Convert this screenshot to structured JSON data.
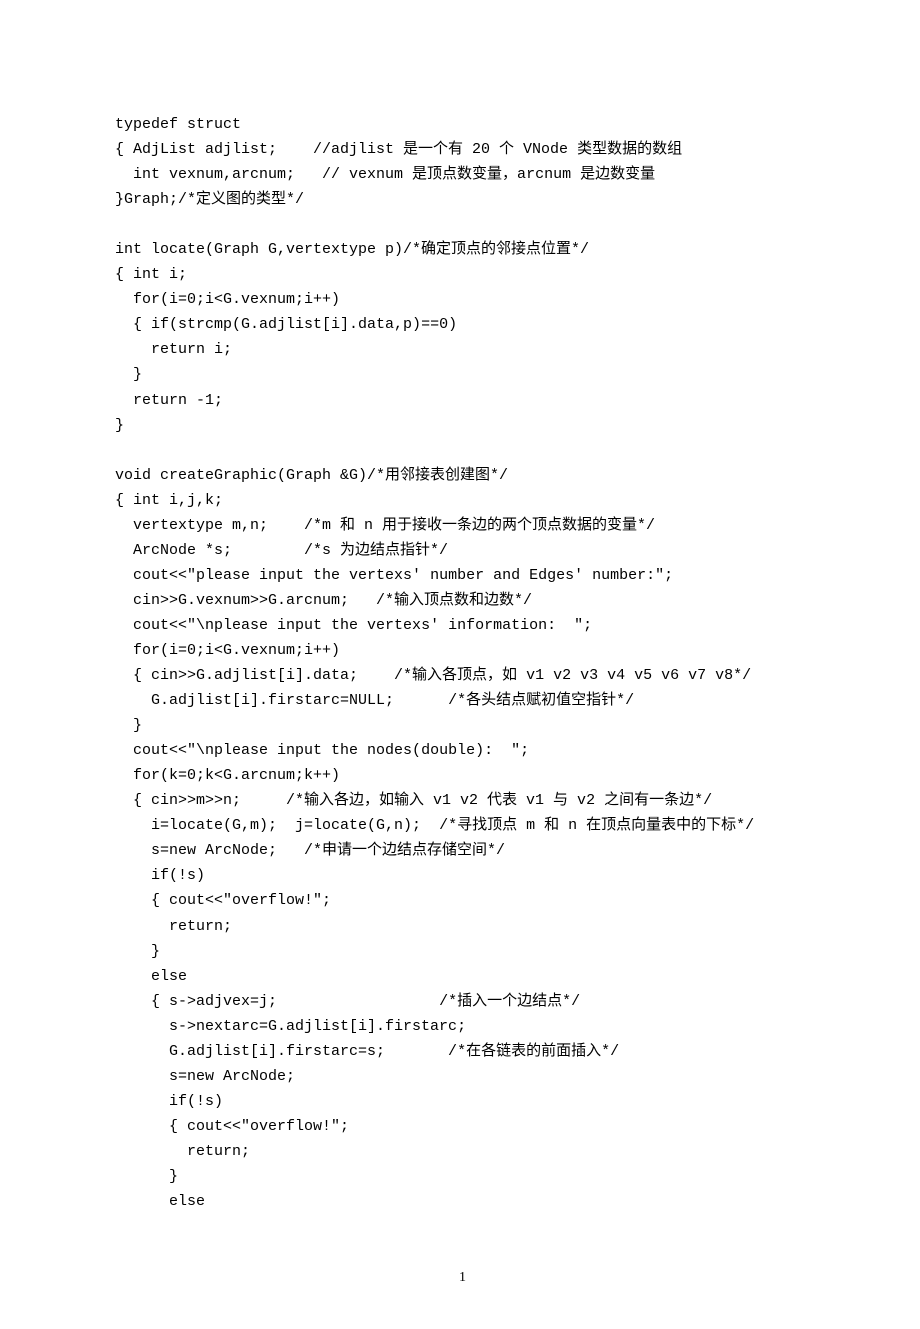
{
  "code": [
    "typedef struct",
    "{ AdjList adjlist;    //adjlist 是一个有 20 个 VNode 类型数据的数组",
    "  int vexnum,arcnum;   // vexnum 是顶点数变量，arcnum 是边数变量",
    "}Graph;/*定义图的类型*/",
    "",
    "int locate(Graph G,vertextype p)/*确定顶点的邻接点位置*/",
    "{ int i;",
    "  for(i=0;i<G.vexnum;i++)",
    "  { if(strcmp(G.adjlist[i].data,p)==0)",
    "    return i;",
    "  }",
    "  return -1;",
    "}",
    "",
    "void createGraphic(Graph &G)/*用邻接表创建图*/",
    "{ int i,j,k;",
    "  vertextype m,n;    /*m 和 n 用于接收一条边的两个顶点数据的变量*/",
    "  ArcNode *s;        /*s 为边结点指针*/",
    "  cout<<\"please input the vertexs' number and Edges' number:\";",
    "  cin>>G.vexnum>>G.arcnum;   /*输入顶点数和边数*/",
    "  cout<<\"\\nplease input the vertexs' information:  \";",
    "  for(i=0;i<G.vexnum;i++)",
    "  { cin>>G.adjlist[i].data;    /*输入各顶点，如 v1 v2 v3 v4 v5 v6 v7 v8*/",
    "    G.adjlist[i].firstarc=NULL;      /*各头结点赋初值空指针*/",
    "  }",
    "  cout<<\"\\nplease input the nodes(double):  \";",
    "  for(k=0;k<G.arcnum;k++)",
    "  { cin>>m>>n;     /*输入各边，如输入 v1 v2 代表 v1 与 v2 之间有一条边*/",
    "    i=locate(G,m);  j=locate(G,n);  /*寻找顶点 m 和 n 在顶点向量表中的下标*/",
    "    s=new ArcNode;   /*申请一个边结点存储空间*/",
    "    if(!s)",
    "    { cout<<\"overflow!\";",
    "      return;",
    "    }",
    "    else",
    "    { s->adjvex=j;                  /*插入一个边结点*/",
    "      s->nextarc=G.adjlist[i].firstarc;",
    "      G.adjlist[i].firstarc=s;       /*在各链表的前面插入*/",
    "      s=new ArcNode;",
    "      if(!s)",
    "      { cout<<\"overflow!\";",
    "        return;",
    "      }",
    "      else"
  ],
  "pageNumber": "1"
}
